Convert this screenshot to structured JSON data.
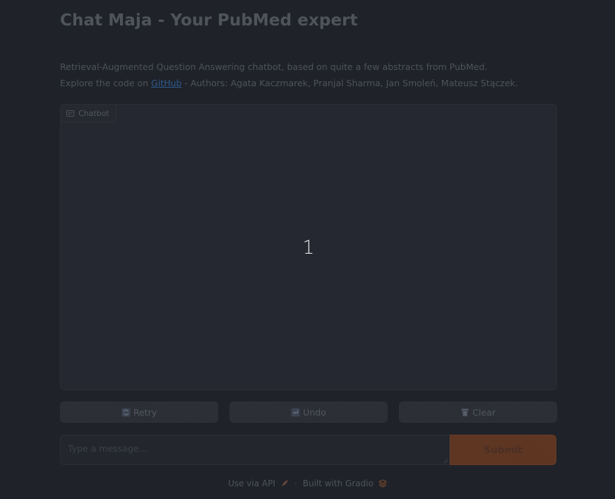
{
  "header": {
    "title": "Chat Maja - Your PubMed expert"
  },
  "description": {
    "line1": "Retrieval-Augmented Question Answering chatbot, based on quite a few abstracts from PubMed.",
    "line2_prefix": "Explore the code on ",
    "github_link": "GitHub",
    "line2_suffix": " - Authors: Agata Kaczmarek, Pranjal Sharma, Jan Smoleń, Mateusz Stączek."
  },
  "chatbot": {
    "label": "Chatbot",
    "queue_number": "1",
    "icon": "chat-bubble-icon"
  },
  "actions": {
    "retry": {
      "label": "Retry",
      "icon": "retry-icon"
    },
    "undo": {
      "label": "Undo",
      "icon": "undo-icon"
    },
    "clear": {
      "label": "Clear",
      "icon": "trash-icon"
    }
  },
  "input": {
    "placeholder": "Type a message...",
    "value": ""
  },
  "submit": {
    "label": "Submit"
  },
  "footer": {
    "api_label": "Use via API",
    "separator": "·",
    "built_label": "Built with Gradio"
  },
  "colors": {
    "background": "#1f2229",
    "panel": "#252830",
    "submit_accent": "#5c3420",
    "text_muted": "#4f535b",
    "link": "#2e5a8c"
  }
}
